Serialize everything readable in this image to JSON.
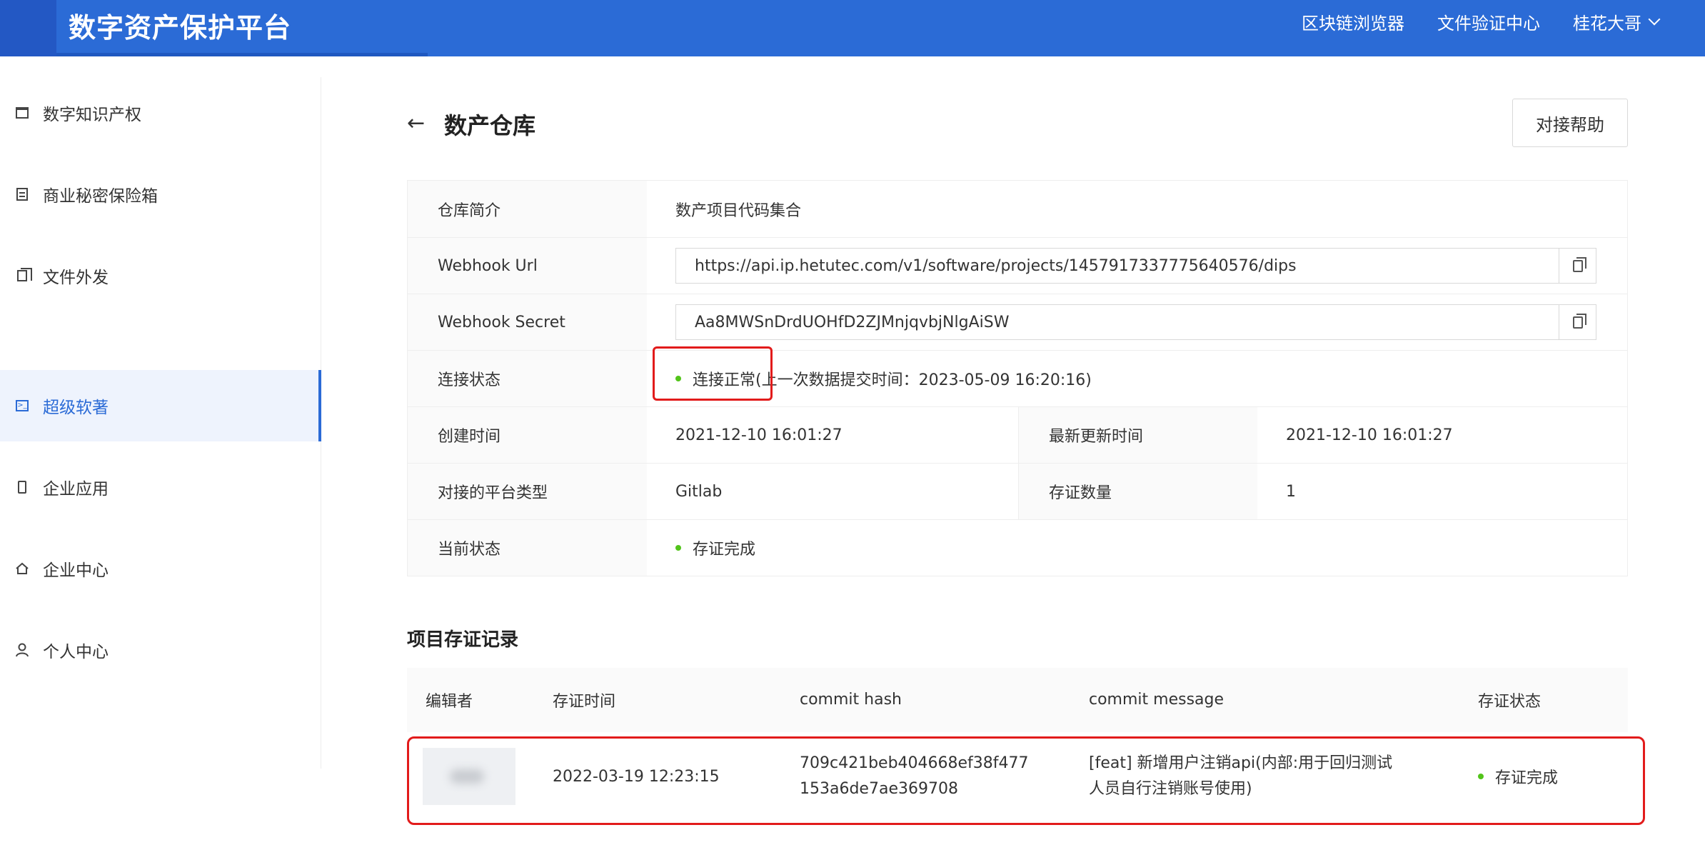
{
  "header": {
    "title": "数字资产保护平台",
    "nav": [
      "区块链浏览器",
      "文件验证中心"
    ],
    "user": "桂花大哥"
  },
  "sidebar": {
    "items": [
      {
        "label": "数字知识产权",
        "icon": "calendar-icon"
      },
      {
        "label": "商业秘密保险箱",
        "icon": "list-icon"
      },
      {
        "label": "文件外发",
        "icon": "copy-icon"
      },
      {
        "label": "超级软著",
        "icon": "terminal-icon",
        "active": true
      },
      {
        "label": "企业应用",
        "icon": "phone-icon"
      },
      {
        "label": "企业中心",
        "icon": "home-icon"
      },
      {
        "label": "个人中心",
        "icon": "user-icon"
      }
    ]
  },
  "page": {
    "title": "数产仓库",
    "help_button": "对接帮助"
  },
  "info": {
    "intro_label": "仓库简介",
    "intro_value": "数产项目代码集合",
    "webhook_url_label": "Webhook Url",
    "webhook_url": "https://api.ip.hetutec.com/v1/software/projects/1457917337775640576/dips",
    "webhook_secret_label": "Webhook Secret",
    "webhook_secret": "Aa8MWSnDrdUOHfD2ZJMnjqvbjNlgAiSW",
    "connection_label": "连接状态",
    "connection_status": "连接正常",
    "connection_detail": "(上一次数据提交时间：2023-05-09 16:20:16)",
    "created_label": "创建时间",
    "created_value": "2021-12-10 16:01:27",
    "updated_label": "最新更新时间",
    "updated_value": "2021-12-10 16:01:27",
    "platform_label": "对接的平台类型",
    "platform_value": "Gitlab",
    "count_label": "存证数量",
    "count_value": "1",
    "state_label": "当前状态",
    "state_value": "存证完成",
    "status_color": "#52c41a"
  },
  "records": {
    "title": "项目存证记录",
    "columns": [
      "编辑者",
      "存证时间",
      "commit hash",
      "commit message",
      "存证状态"
    ],
    "rows": [
      {
        "time": "2022-03-19 12:23:15",
        "hash_line1": "709c421beb404668ef38f477",
        "hash_line2": "153a6de7ae369708",
        "message_line1": "[feat] 新增用户注销api(内部:用于回归测试",
        "message_line2": "人员自行注销账号使用)",
        "status": "存证完成"
      }
    ]
  },
  "colors": {
    "brand": "#2b6bd6",
    "highlight": "#e21b1b"
  }
}
